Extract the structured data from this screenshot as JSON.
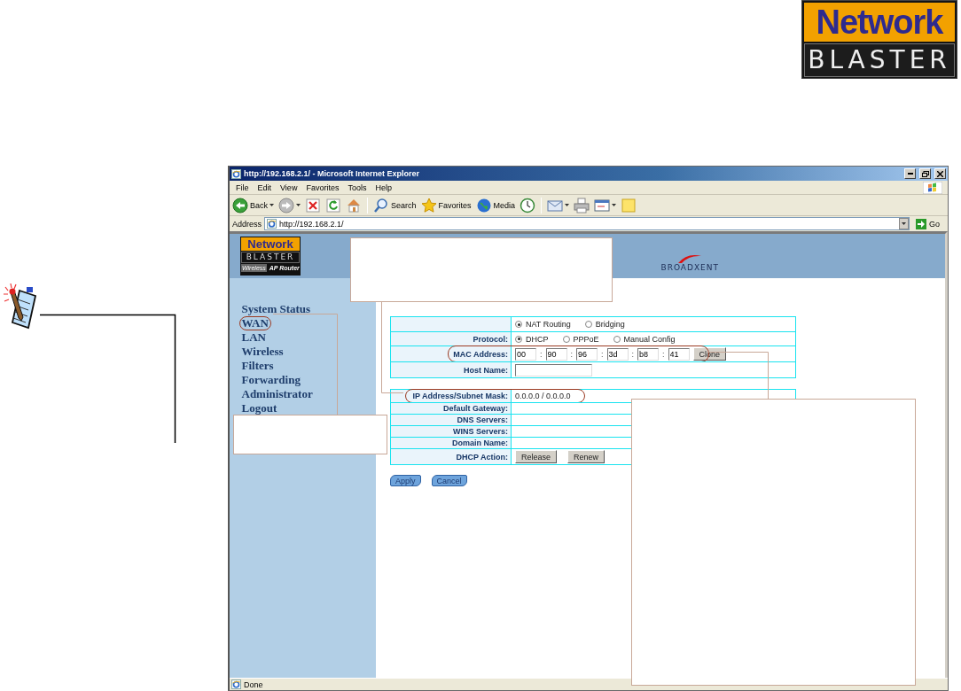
{
  "doc_logo": {
    "top": "Network",
    "bottom": "BLASTER"
  },
  "browser": {
    "title": "http://192.168.2.1/ - Microsoft Internet Explorer",
    "menu": [
      "File",
      "Edit",
      "View",
      "Favorites",
      "Tools",
      "Help"
    ],
    "toolbar": [
      {
        "kind": "back",
        "label": "Back",
        "dropdown": true
      },
      {
        "kind": "forward",
        "dropdown": true
      },
      {
        "kind": "stop",
        "dropdown": false
      },
      {
        "kind": "refresh",
        "dropdown": false
      },
      {
        "kind": "home",
        "dropdown": false
      },
      {
        "kind": "separator"
      },
      {
        "kind": "search",
        "label": "Search",
        "dropdown": false
      },
      {
        "kind": "favorites",
        "label": "Favorites",
        "dropdown": false
      },
      {
        "kind": "media",
        "label": "Media",
        "dropdown": false
      },
      {
        "kind": "history",
        "dropdown": false
      },
      {
        "kind": "separator"
      },
      {
        "kind": "mail",
        "dropdown": true
      },
      {
        "kind": "print",
        "dropdown": false
      },
      {
        "kind": "edit",
        "dropdown": true
      },
      {
        "kind": "note",
        "dropdown": false
      }
    ],
    "address": {
      "label": "Address",
      "value": "http://192.168.2.1/",
      "go": "Go"
    },
    "status": "Done"
  },
  "router": {
    "logo": {
      "top": "Network",
      "middle": "BLASTER",
      "badge": "Wireless",
      "subtitle": "AP Router"
    },
    "brand": "BROADXENT",
    "nav": [
      {
        "label": "System Status",
        "highlighted": false
      },
      {
        "label": "WAN",
        "highlighted": true
      },
      {
        "label": "LAN",
        "highlighted": false
      },
      {
        "label": "Wireless",
        "highlighted": false
      },
      {
        "label": "Filters",
        "highlighted": false
      },
      {
        "label": "Forwarding",
        "highlighted": false
      },
      {
        "label": "Administrator",
        "highlighted": false
      },
      {
        "label": "Logout",
        "highlighted": false
      }
    ],
    "sections": [
      {
        "rows": [
          {
            "kind": "radios",
            "highlighted": false,
            "options": [
              {
                "label": "NAT Routing",
                "selected": true
              },
              {
                "label": "Bridging",
                "selected": false
              }
            ]
          },
          {
            "kind": "radios",
            "label": "Protocol:",
            "highlighted": false,
            "options": [
              {
                "label": "DHCP",
                "selected": true
              },
              {
                "label": "PPPoE",
                "selected": false
              },
              {
                "label": "Manual Config",
                "selected": false
              }
            ]
          },
          {
            "kind": "mac",
            "label": "MAC Address:",
            "highlighted": true,
            "octets": [
              "00",
              "90",
              "96",
              "3d",
              "b8",
              "41"
            ],
            "separator": ":",
            "button": "Clone"
          },
          {
            "kind": "input",
            "label": "Host Name:",
            "highlighted": false
          }
        ]
      },
      {
        "rows": [
          {
            "kind": "text",
            "label": "IP Address/Subnet Mask:",
            "highlighted": true,
            "value": "0.0.0.0 / 0.0.0.0"
          },
          {
            "kind": "text",
            "label": "Default Gateway:",
            "highlighted": false
          },
          {
            "kind": "text",
            "label": "DNS Servers:",
            "highlighted": false
          },
          {
            "kind": "text",
            "label": "WINS Servers:",
            "highlighted": false
          },
          {
            "kind": "text",
            "label": "Domain Name:",
            "highlighted": false
          },
          {
            "kind": "buttons",
            "label": "DHCP Action:",
            "highlighted": false,
            "buttons": [
              "Release",
              "Renew"
            ]
          }
        ]
      }
    ],
    "actions": [
      "Apply",
      "Cancel"
    ]
  }
}
